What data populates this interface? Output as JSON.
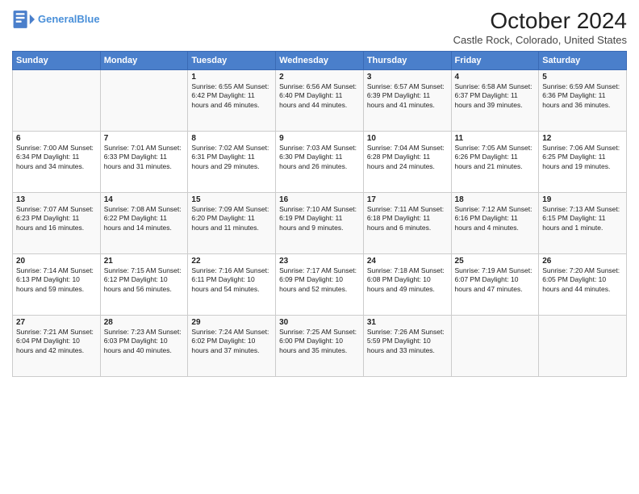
{
  "header": {
    "logo_line1": "General",
    "logo_line2": "Blue",
    "title": "October 2024",
    "subtitle": "Castle Rock, Colorado, United States"
  },
  "days_of_week": [
    "Sunday",
    "Monday",
    "Tuesday",
    "Wednesday",
    "Thursday",
    "Friday",
    "Saturday"
  ],
  "weeks": [
    [
      {
        "day": "",
        "text": ""
      },
      {
        "day": "",
        "text": ""
      },
      {
        "day": "1",
        "text": "Sunrise: 6:55 AM\nSunset: 6:42 PM\nDaylight: 11 hours and 46 minutes."
      },
      {
        "day": "2",
        "text": "Sunrise: 6:56 AM\nSunset: 6:40 PM\nDaylight: 11 hours and 44 minutes."
      },
      {
        "day": "3",
        "text": "Sunrise: 6:57 AM\nSunset: 6:39 PM\nDaylight: 11 hours and 41 minutes."
      },
      {
        "day": "4",
        "text": "Sunrise: 6:58 AM\nSunset: 6:37 PM\nDaylight: 11 hours and 39 minutes."
      },
      {
        "day": "5",
        "text": "Sunrise: 6:59 AM\nSunset: 6:36 PM\nDaylight: 11 hours and 36 minutes."
      }
    ],
    [
      {
        "day": "6",
        "text": "Sunrise: 7:00 AM\nSunset: 6:34 PM\nDaylight: 11 hours and 34 minutes."
      },
      {
        "day": "7",
        "text": "Sunrise: 7:01 AM\nSunset: 6:33 PM\nDaylight: 11 hours and 31 minutes."
      },
      {
        "day": "8",
        "text": "Sunrise: 7:02 AM\nSunset: 6:31 PM\nDaylight: 11 hours and 29 minutes."
      },
      {
        "day": "9",
        "text": "Sunrise: 7:03 AM\nSunset: 6:30 PM\nDaylight: 11 hours and 26 minutes."
      },
      {
        "day": "10",
        "text": "Sunrise: 7:04 AM\nSunset: 6:28 PM\nDaylight: 11 hours and 24 minutes."
      },
      {
        "day": "11",
        "text": "Sunrise: 7:05 AM\nSunset: 6:26 PM\nDaylight: 11 hours and 21 minutes."
      },
      {
        "day": "12",
        "text": "Sunrise: 7:06 AM\nSunset: 6:25 PM\nDaylight: 11 hours and 19 minutes."
      }
    ],
    [
      {
        "day": "13",
        "text": "Sunrise: 7:07 AM\nSunset: 6:23 PM\nDaylight: 11 hours and 16 minutes."
      },
      {
        "day": "14",
        "text": "Sunrise: 7:08 AM\nSunset: 6:22 PM\nDaylight: 11 hours and 14 minutes."
      },
      {
        "day": "15",
        "text": "Sunrise: 7:09 AM\nSunset: 6:20 PM\nDaylight: 11 hours and 11 minutes."
      },
      {
        "day": "16",
        "text": "Sunrise: 7:10 AM\nSunset: 6:19 PM\nDaylight: 11 hours and 9 minutes."
      },
      {
        "day": "17",
        "text": "Sunrise: 7:11 AM\nSunset: 6:18 PM\nDaylight: 11 hours and 6 minutes."
      },
      {
        "day": "18",
        "text": "Sunrise: 7:12 AM\nSunset: 6:16 PM\nDaylight: 11 hours and 4 minutes."
      },
      {
        "day": "19",
        "text": "Sunrise: 7:13 AM\nSunset: 6:15 PM\nDaylight: 11 hours and 1 minute."
      }
    ],
    [
      {
        "day": "20",
        "text": "Sunrise: 7:14 AM\nSunset: 6:13 PM\nDaylight: 10 hours and 59 minutes."
      },
      {
        "day": "21",
        "text": "Sunrise: 7:15 AM\nSunset: 6:12 PM\nDaylight: 10 hours and 56 minutes."
      },
      {
        "day": "22",
        "text": "Sunrise: 7:16 AM\nSunset: 6:11 PM\nDaylight: 10 hours and 54 minutes."
      },
      {
        "day": "23",
        "text": "Sunrise: 7:17 AM\nSunset: 6:09 PM\nDaylight: 10 hours and 52 minutes."
      },
      {
        "day": "24",
        "text": "Sunrise: 7:18 AM\nSunset: 6:08 PM\nDaylight: 10 hours and 49 minutes."
      },
      {
        "day": "25",
        "text": "Sunrise: 7:19 AM\nSunset: 6:07 PM\nDaylight: 10 hours and 47 minutes."
      },
      {
        "day": "26",
        "text": "Sunrise: 7:20 AM\nSunset: 6:05 PM\nDaylight: 10 hours and 44 minutes."
      }
    ],
    [
      {
        "day": "27",
        "text": "Sunrise: 7:21 AM\nSunset: 6:04 PM\nDaylight: 10 hours and 42 minutes."
      },
      {
        "day": "28",
        "text": "Sunrise: 7:23 AM\nSunset: 6:03 PM\nDaylight: 10 hours and 40 minutes."
      },
      {
        "day": "29",
        "text": "Sunrise: 7:24 AM\nSunset: 6:02 PM\nDaylight: 10 hours and 37 minutes."
      },
      {
        "day": "30",
        "text": "Sunrise: 7:25 AM\nSunset: 6:00 PM\nDaylight: 10 hours and 35 minutes."
      },
      {
        "day": "31",
        "text": "Sunrise: 7:26 AM\nSunset: 5:59 PM\nDaylight: 10 hours and 33 minutes."
      },
      {
        "day": "",
        "text": ""
      },
      {
        "day": "",
        "text": ""
      }
    ]
  ]
}
